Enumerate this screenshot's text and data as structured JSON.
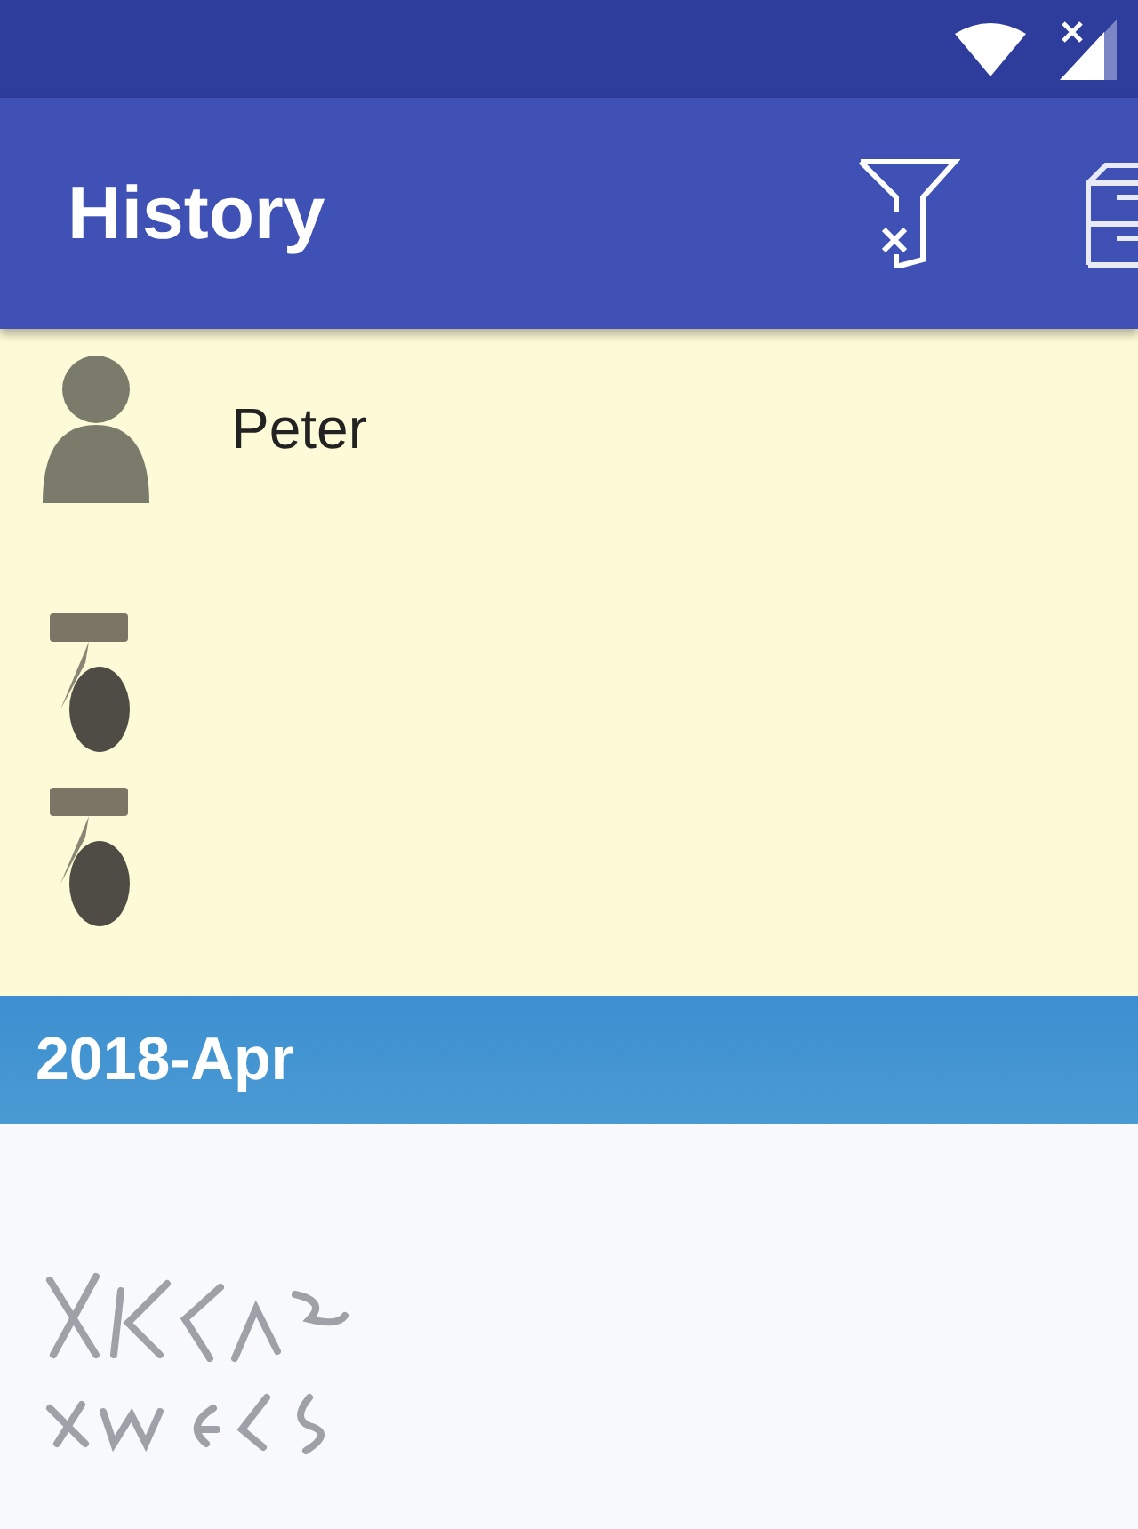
{
  "app_bar": {
    "title": "History"
  },
  "person": {
    "name": "Peter"
  },
  "section": {
    "title": "2018-Apr"
  }
}
